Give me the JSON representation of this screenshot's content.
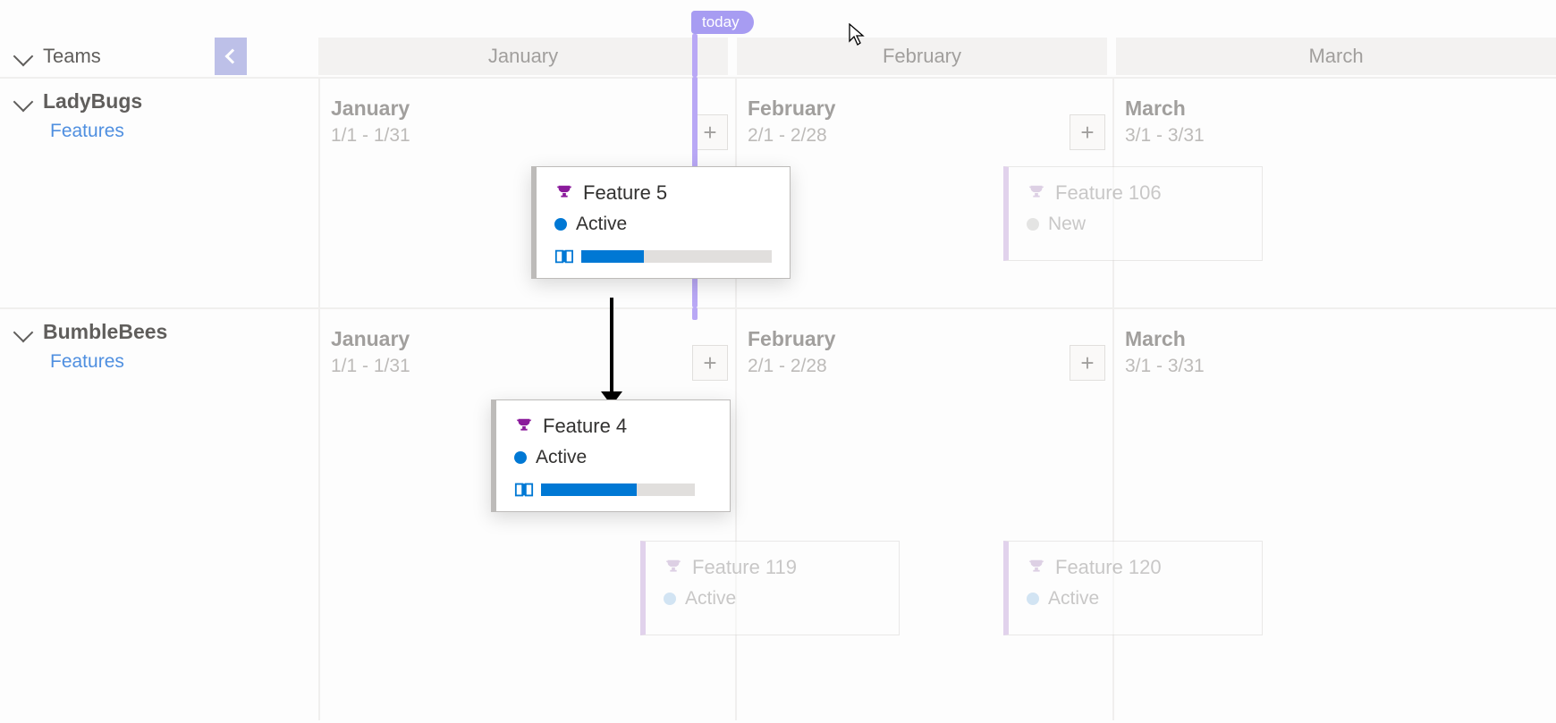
{
  "today_label": "today",
  "header": {
    "root_label": "Teams",
    "months": [
      "January",
      "February",
      "March"
    ]
  },
  "lanes": [
    {
      "group": "LadyBugs",
      "sub_label": "Features",
      "months": [
        {
          "name": "January",
          "range": "1/1 - 1/31"
        },
        {
          "name": "February",
          "range": "2/1 - 2/28"
        },
        {
          "name": "March",
          "range": "3/1 - 3/31"
        }
      ]
    },
    {
      "group": "BumbleBees",
      "sub_label": "Features",
      "months": [
        {
          "name": "January",
          "range": "1/1 - 1/31"
        },
        {
          "name": "February",
          "range": "2/1 - 2/28"
        },
        {
          "name": "March",
          "range": "3/1 - 3/31"
        }
      ]
    }
  ],
  "cards": {
    "feature5": {
      "title": "Feature 5",
      "status": "Active",
      "progress": 0.33
    },
    "feature106": {
      "title": "Feature 106",
      "status": "New"
    },
    "feature4": {
      "title": "Feature 4",
      "status": "Active",
      "progress": 0.62
    },
    "feature119": {
      "title": "Feature 119",
      "status": "Active"
    },
    "feature120": {
      "title": "Feature 120",
      "status": "Active"
    }
  }
}
